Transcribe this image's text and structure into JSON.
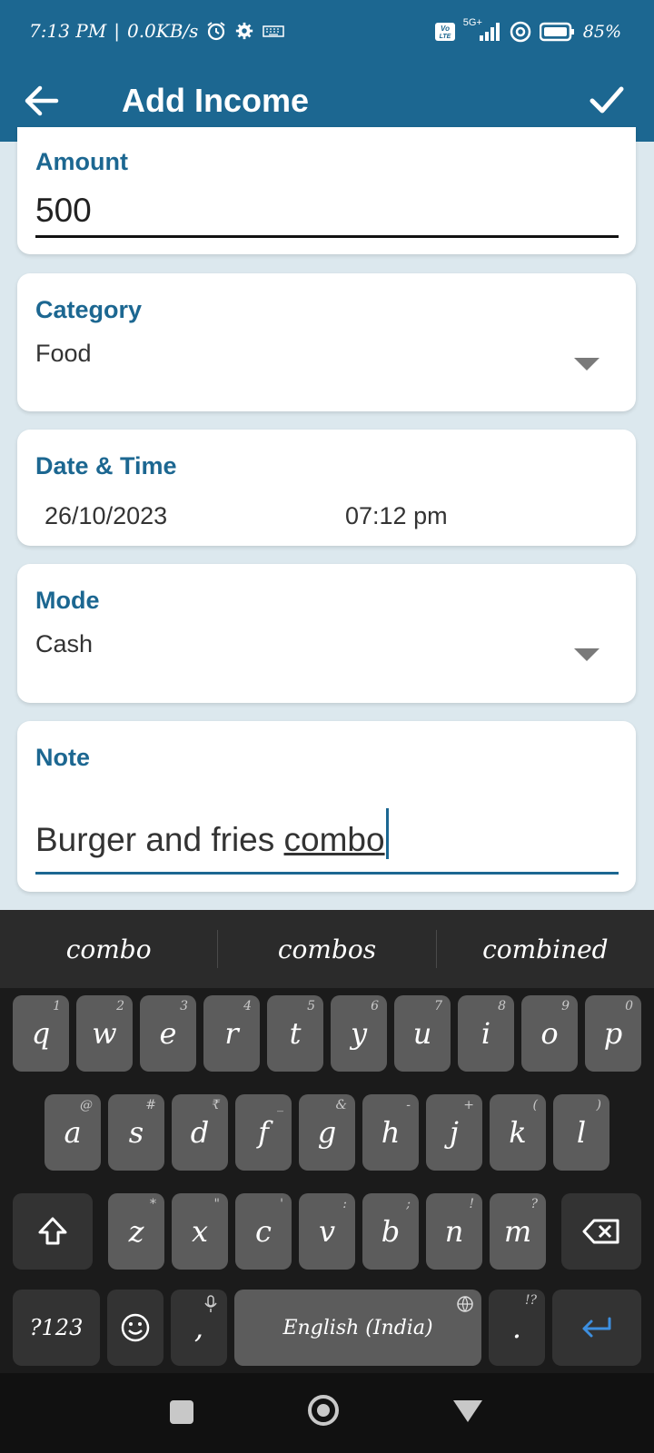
{
  "status_bar": {
    "time": "7:13 PM",
    "speed": "0.0KB/s",
    "network": "5G+",
    "battery": "85%",
    "icons": [
      "alarm-icon",
      "settings-icon",
      "keyboard-icon",
      "volte-icon",
      "signal-icon",
      "hotspot-icon",
      "battery-icon"
    ]
  },
  "app_bar": {
    "title": "Add Income",
    "back_icon": "back-arrow-icon",
    "save_icon": "check-icon"
  },
  "form": {
    "amount": {
      "label": "Amount",
      "value": "500"
    },
    "category": {
      "label": "Category",
      "value": "Food"
    },
    "datetime": {
      "label": "Date & Time",
      "date": "26/10/2023",
      "time": "07:12 pm"
    },
    "mode": {
      "label": "Mode",
      "value": "Cash"
    },
    "note": {
      "label": "Note",
      "value_plain": "Burger and fries ",
      "value_composing": "combo"
    }
  },
  "keyboard": {
    "suggestions": [
      "combo",
      "combos",
      "combined"
    ],
    "row1": [
      {
        "k": "q",
        "h": "1"
      },
      {
        "k": "w",
        "h": "2"
      },
      {
        "k": "e",
        "h": "3"
      },
      {
        "k": "r",
        "h": "4"
      },
      {
        "k": "t",
        "h": "5"
      },
      {
        "k": "y",
        "h": "6"
      },
      {
        "k": "u",
        "h": "7"
      },
      {
        "k": "i",
        "h": "8"
      },
      {
        "k": "o",
        "h": "9"
      },
      {
        "k": "p",
        "h": "0"
      }
    ],
    "row2": [
      {
        "k": "a",
        "h": "@"
      },
      {
        "k": "s",
        "h": "#"
      },
      {
        "k": "d",
        "h": "₹"
      },
      {
        "k": "f",
        "h": "_"
      },
      {
        "k": "g",
        "h": "&"
      },
      {
        "k": "h",
        "h": "-"
      },
      {
        "k": "j",
        "h": "+"
      },
      {
        "k": "k",
        "h": "("
      },
      {
        "k": "l",
        "h": ")"
      }
    ],
    "row3": [
      {
        "k": "z",
        "h": "*"
      },
      {
        "k": "x",
        "h": "\""
      },
      {
        "k": "c",
        "h": "'"
      },
      {
        "k": "v",
        "h": ":"
      },
      {
        "k": "b",
        "h": ";"
      },
      {
        "k": "n",
        "h": "!"
      },
      {
        "k": "m",
        "h": "?"
      }
    ],
    "symbols_key": "?123",
    "comma": ",",
    "space_label": "English (India)",
    "period": ".",
    "period_hint": "!?"
  },
  "colors": {
    "primary": "#1c6791",
    "background": "#dce8ee",
    "keyboard_bg": "#1b1b1b",
    "key_bg": "#5c5c5c",
    "enter_blue": "#3d8fe0"
  }
}
